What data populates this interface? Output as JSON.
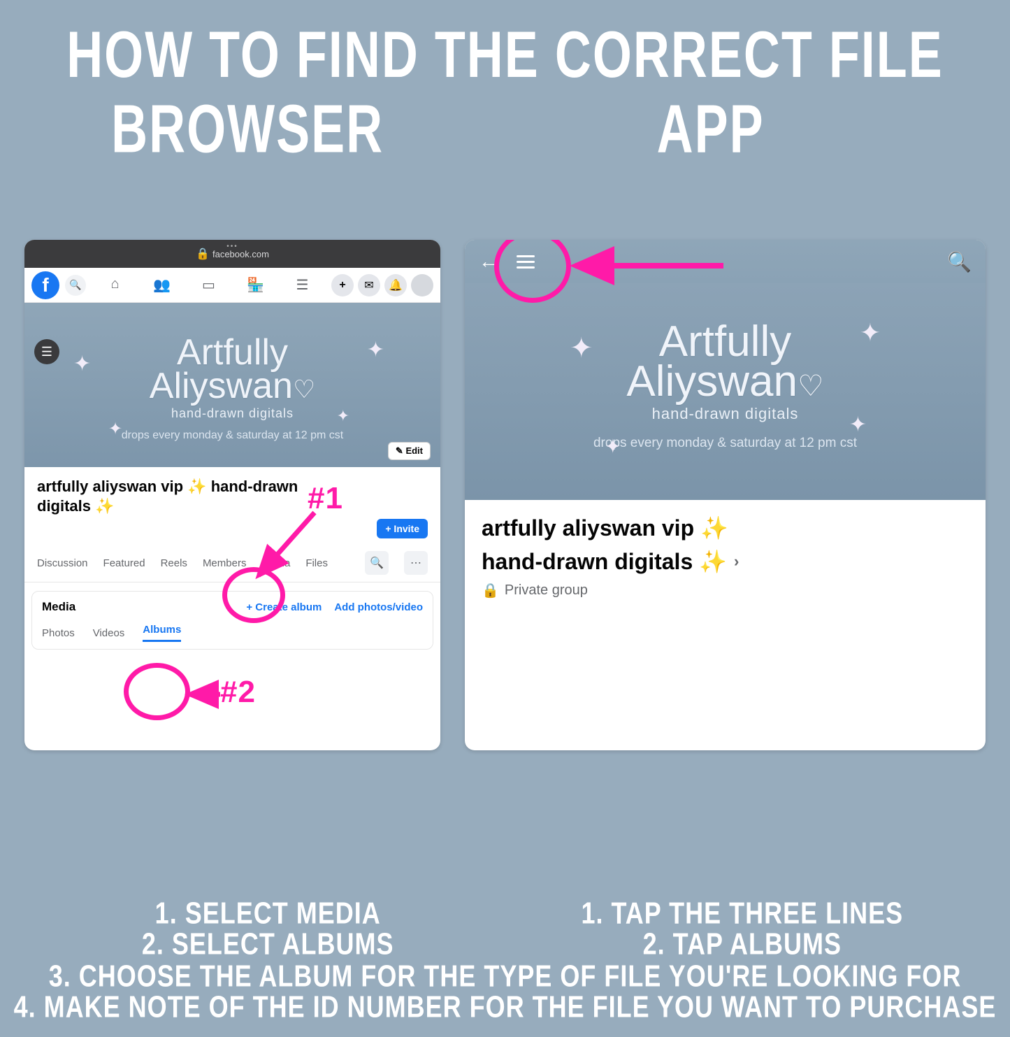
{
  "title": "HOW TO FIND THE CORRECT FILE",
  "columns": {
    "left": "BROWSER",
    "right": "APP"
  },
  "browser": {
    "url_label": "facebook.com",
    "cover": {
      "brand_line1": "Artfully",
      "brand_line2": "Aliyswan",
      "subtitle": "hand-drawn digitals",
      "schedule": "drops every monday & saturday at 12 pm cst"
    },
    "edit_label": "Edit",
    "group_title": "artfully aliyswan vip ✨ hand-drawn digitals ✨",
    "invite_label": "+ Invite",
    "tabs": [
      "Discussion",
      "Featured",
      "Reels",
      "Members",
      "Media",
      "Files"
    ],
    "media_card": {
      "title": "Media",
      "create_album": "+  Create album",
      "add_photos": "Add photos/video",
      "subtabs": [
        "Photos",
        "Videos",
        "Albums"
      ],
      "active_subtab": "Albums"
    },
    "annotations": {
      "one": "#1",
      "two": "#2"
    }
  },
  "app": {
    "cover": {
      "brand_line1": "Artfully",
      "brand_line2": "Aliyswan",
      "subtitle": "hand-drawn digitals",
      "schedule": "drops every monday & saturday at 12 pm cst"
    },
    "group_title_line1": "artfully aliyswan vip ✨",
    "group_title_line2": "hand-drawn digitals ✨",
    "privacy": "Private group"
  },
  "instructions": {
    "left": [
      "1. SELECT MEDIA",
      "2. SELECT ALBUMS"
    ],
    "right": [
      "1. TAP THE THREE LINES",
      "2. TAP ALBUMS"
    ],
    "wide": [
      "3. CHOOSE THE ALBUM FOR THE TYPE OF FILE YOU'RE LOOKING FOR",
      "4. MAKE NOTE OF THE ID NUMBER FOR THE FILE YOU WANT TO PURCHASE"
    ]
  },
  "colors": {
    "pink": "#ff1aa8",
    "fb_blue": "#1877f2"
  }
}
